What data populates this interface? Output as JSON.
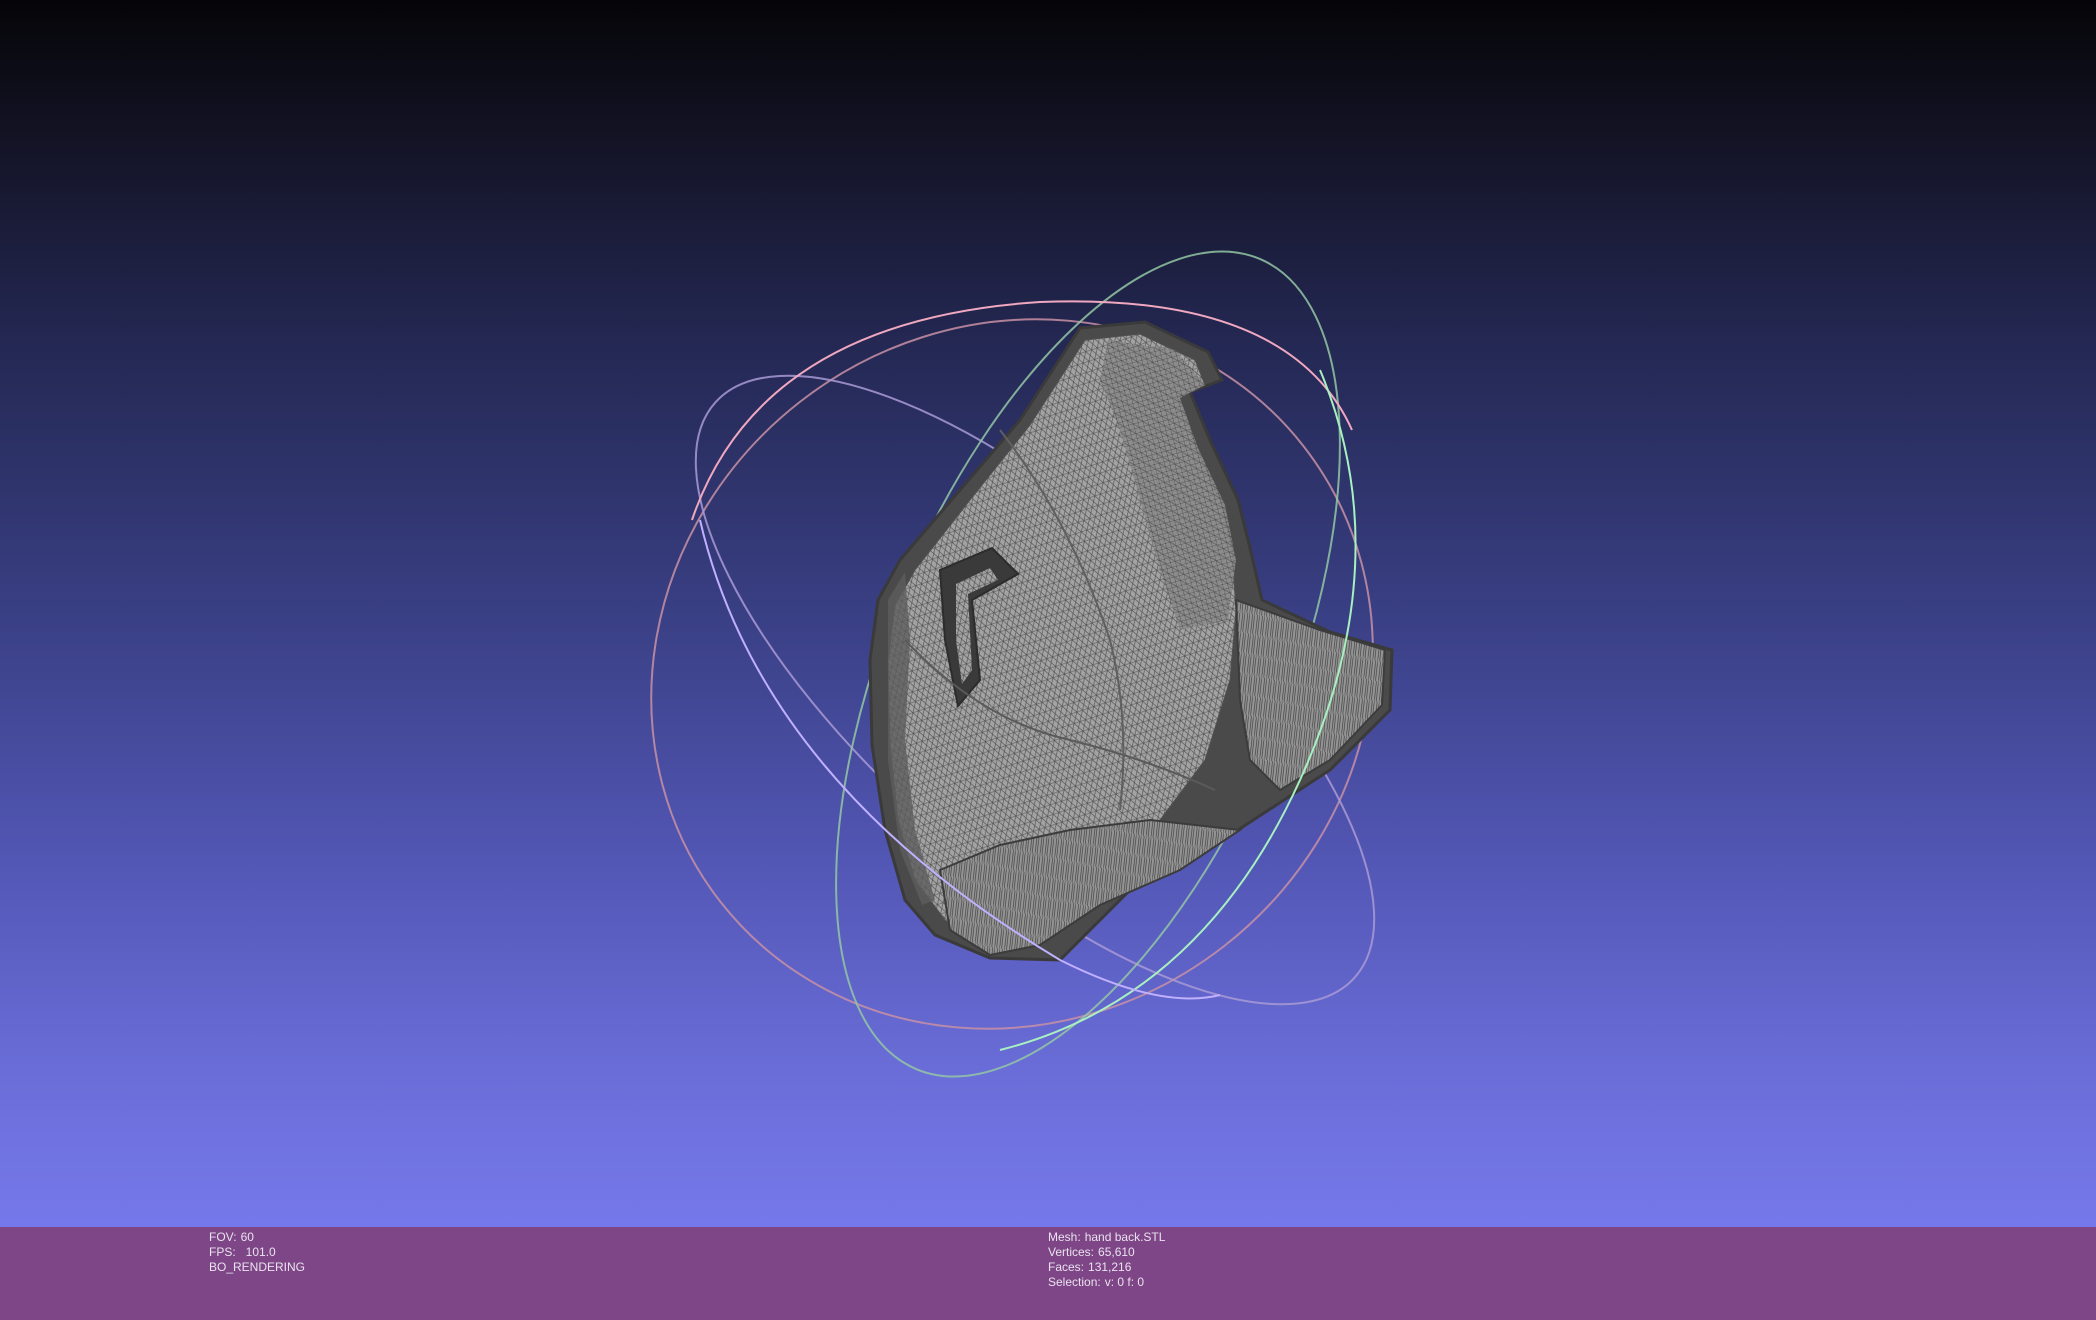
{
  "info_left": {
    "fov_label": "FOV:",
    "fov_value": "60",
    "fps_label": "FPS:",
    "fps_value": "101.0",
    "render_mode": "BO_RENDERING"
  },
  "info_right": {
    "mesh_label": "Mesh:",
    "mesh_value": "hand back.STL",
    "vertices_label": "Vertices:",
    "vertices_value": "65,610",
    "faces_label": "Faces:",
    "faces_value": "131,216",
    "selection_label": "Selection:",
    "selection_value": "v: 0 f: 0"
  },
  "colors": {
    "info_bar_bg": "#7e4687",
    "mesh_fill": "#9a9a9a",
    "mesh_edge": "#555555",
    "trackball_red": "#e7a0b8",
    "trackball_green": "#9fd8b2",
    "trackball_blue": "#b4a8e8"
  },
  "icons": {
    "trackball": "trackball-rings-icon"
  }
}
